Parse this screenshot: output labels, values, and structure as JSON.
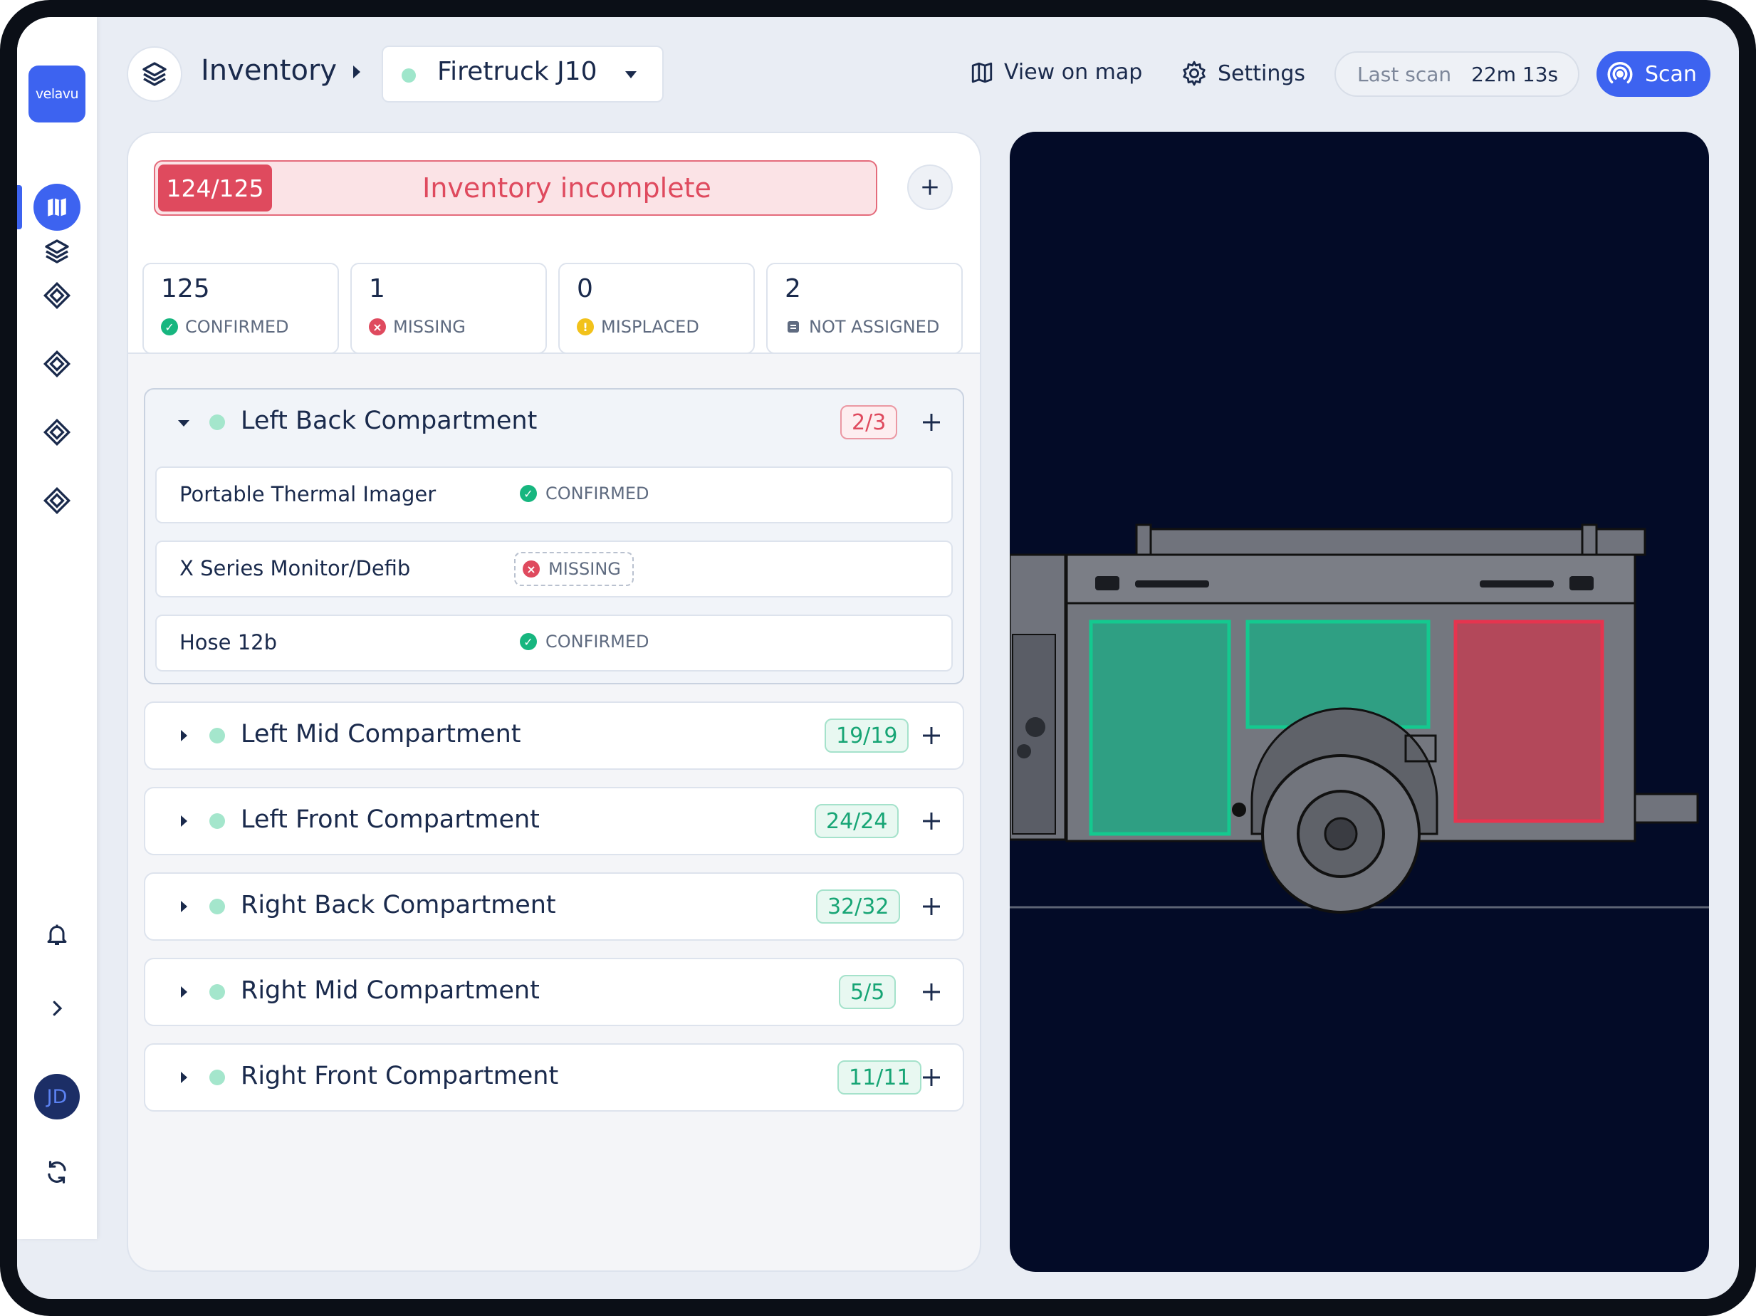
{
  "app": {
    "logo_text": "velavu"
  },
  "header": {
    "title": "Inventory",
    "vehicle": "Firetruck J10",
    "view_on_map": "View on map",
    "settings": "Settings",
    "last_scan_label": "Last scan",
    "last_scan_value": "22m 13s",
    "scan_button": "Scan"
  },
  "sidebar": {
    "items": [
      {
        "icon": "map-icon",
        "active": true
      },
      {
        "icon": "layers-icon"
      },
      {
        "icon": "diamond-icon"
      },
      {
        "icon": "diamond-icon"
      },
      {
        "icon": "diamond-icon"
      },
      {
        "icon": "diamond-icon"
      }
    ],
    "bottom": [
      "bell-icon",
      "chevron-right-icon",
      "avatar",
      "sync-icon"
    ],
    "avatar_initials": "JD"
  },
  "summary": {
    "count": "124/125",
    "status": "Inventory incomplete",
    "stats": [
      {
        "value": "125",
        "label": "CONFIRMED"
      },
      {
        "value": "1",
        "label": "MISSING"
      },
      {
        "value": "0",
        "label": "MISPLACED"
      },
      {
        "value": "2",
        "label": "NOT ASSIGNED"
      }
    ]
  },
  "compartments": [
    {
      "name": "Left Back Compartment",
      "count": "2/3",
      "complete": false,
      "expanded": true,
      "items": [
        {
          "name": "Portable Thermal Imager",
          "status": "CONFIRMED"
        },
        {
          "name": "X Series Monitor/Defib",
          "status": "MISSING"
        },
        {
          "name": "Hose 12b",
          "status": "CONFIRMED"
        }
      ]
    },
    {
      "name": "Left Mid Compartment",
      "count": "19/19",
      "complete": true
    },
    {
      "name": "Left Front Compartment",
      "count": "24/24",
      "complete": true
    },
    {
      "name": "Right Back Compartment",
      "count": "32/32",
      "complete": true
    },
    {
      "name": "Right Mid Compartment",
      "count": "5/5",
      "complete": true
    },
    {
      "name": "Right Front Compartment",
      "count": "11/11",
      "complete": true
    }
  ],
  "colors": {
    "accent": "#3d63f0",
    "confirmed": "#17b67f",
    "missing": "#df4a5e",
    "misplaced": "#f2c21b",
    "map_background": "#030b27",
    "compartment_ok": "#2f9f83",
    "compartment_missing": "#b3485a"
  }
}
